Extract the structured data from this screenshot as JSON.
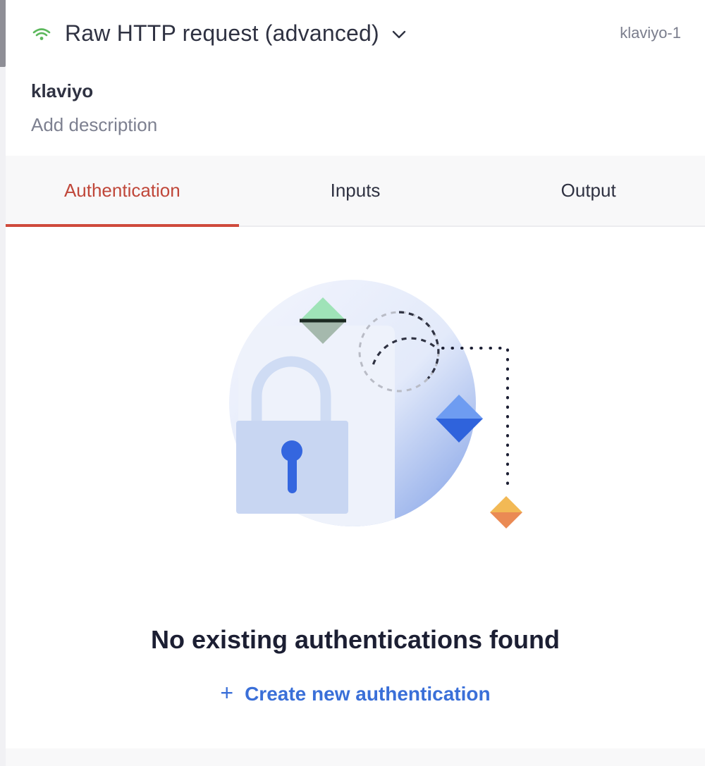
{
  "header": {
    "title": "Raw HTTP request (advanced)",
    "step_id": "klaviyo-1",
    "connector_name": "klaviyo",
    "description_placeholder": "Add description",
    "status_icon": "wifi-icon",
    "status_color": "#5cb85c"
  },
  "tabs": [
    {
      "label": "Authentication",
      "active": true
    },
    {
      "label": "Inputs",
      "active": false
    },
    {
      "label": "Output",
      "active": false
    }
  ],
  "empty_state": {
    "title": "No existing authentications found",
    "create_label": "Create new authentication",
    "create_icon": "+",
    "illustration": "lock-illustration"
  },
  "colors": {
    "accent_active_tab": "#cf4a3c",
    "link_blue": "#3a6fd8"
  }
}
